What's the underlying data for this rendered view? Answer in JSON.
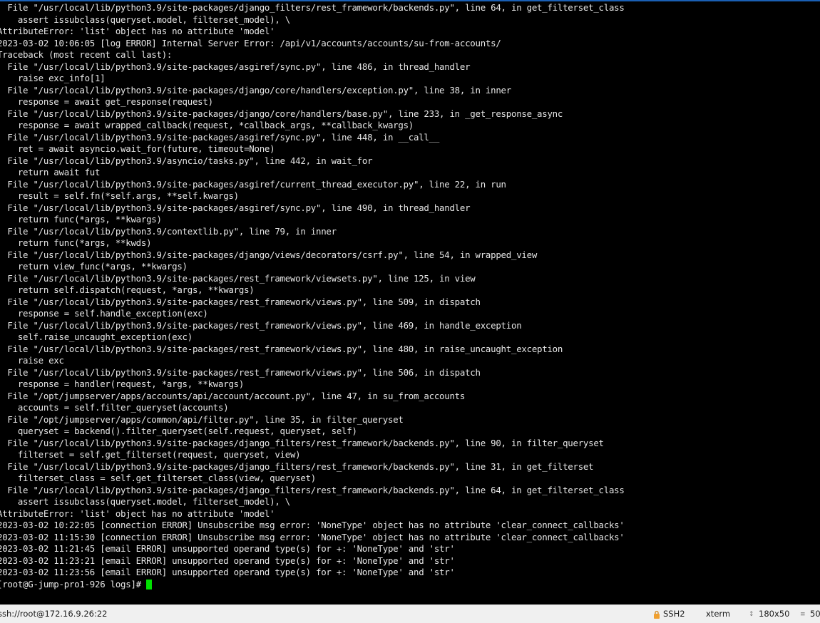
{
  "terminal": {
    "lines": [
      "  File \"/usr/local/lib/python3.9/site-packages/django_filters/rest_framework/backends.py\", line 64, in get_filterset_class",
      "    assert issubclass(queryset.model, filterset_model), \\",
      "AttributeError: 'list' object has no attribute 'model'",
      "2023-03-02 10:06:05 [log ERROR] Internal Server Error: /api/v1/accounts/accounts/su-from-accounts/",
      "Traceback (most recent call last):",
      "  File \"/usr/local/lib/python3.9/site-packages/asgiref/sync.py\", line 486, in thread_handler",
      "    raise exc_info[1]",
      "  File \"/usr/local/lib/python3.9/site-packages/django/core/handlers/exception.py\", line 38, in inner",
      "    response = await get_response(request)",
      "  File \"/usr/local/lib/python3.9/site-packages/django/core/handlers/base.py\", line 233, in _get_response_async",
      "    response = await wrapped_callback(request, *callback_args, **callback_kwargs)",
      "  File \"/usr/local/lib/python3.9/site-packages/asgiref/sync.py\", line 448, in __call__",
      "    ret = await asyncio.wait_for(future, timeout=None)",
      "  File \"/usr/local/lib/python3.9/asyncio/tasks.py\", line 442, in wait_for",
      "    return await fut",
      "  File \"/usr/local/lib/python3.9/site-packages/asgiref/current_thread_executor.py\", line 22, in run",
      "    result = self.fn(*self.args, **self.kwargs)",
      "  File \"/usr/local/lib/python3.9/site-packages/asgiref/sync.py\", line 490, in thread_handler",
      "    return func(*args, **kwargs)",
      "  File \"/usr/local/lib/python3.9/contextlib.py\", line 79, in inner",
      "    return func(*args, **kwds)",
      "  File \"/usr/local/lib/python3.9/site-packages/django/views/decorators/csrf.py\", line 54, in wrapped_view",
      "    return view_func(*args, **kwargs)",
      "  File \"/usr/local/lib/python3.9/site-packages/rest_framework/viewsets.py\", line 125, in view",
      "    return self.dispatch(request, *args, **kwargs)",
      "  File \"/usr/local/lib/python3.9/site-packages/rest_framework/views.py\", line 509, in dispatch",
      "    response = self.handle_exception(exc)",
      "  File \"/usr/local/lib/python3.9/site-packages/rest_framework/views.py\", line 469, in handle_exception",
      "    self.raise_uncaught_exception(exc)",
      "  File \"/usr/local/lib/python3.9/site-packages/rest_framework/views.py\", line 480, in raise_uncaught_exception",
      "    raise exc",
      "  File \"/usr/local/lib/python3.9/site-packages/rest_framework/views.py\", line 506, in dispatch",
      "    response = handler(request, *args, **kwargs)",
      "  File \"/opt/jumpserver/apps/accounts/api/account/account.py\", line 47, in su_from_accounts",
      "    accounts = self.filter_queryset(accounts)",
      "  File \"/opt/jumpserver/apps/common/api/filter.py\", line 35, in filter_queryset",
      "    queryset = backend().filter_queryset(self.request, queryset, self)",
      "  File \"/usr/local/lib/python3.9/site-packages/django_filters/rest_framework/backends.py\", line 90, in filter_queryset",
      "    filterset = self.get_filterset(request, queryset, view)",
      "  File \"/usr/local/lib/python3.9/site-packages/django_filters/rest_framework/backends.py\", line 31, in get_filterset",
      "    filterset_class = self.get_filterset_class(view, queryset)",
      "  File \"/usr/local/lib/python3.9/site-packages/django_filters/rest_framework/backends.py\", line 64, in get_filterset_class",
      "    assert issubclass(queryset.model, filterset_model), \\",
      "AttributeError: 'list' object has no attribute 'model'",
      "2023-03-02 10:22:05 [connection ERROR] Unsubscribe msg error: 'NoneType' object has no attribute 'clear_connect_callbacks'",
      "2023-03-02 11:15:30 [connection ERROR] Unsubscribe msg error: 'NoneType' object has no attribute 'clear_connect_callbacks'",
      "2023-03-02 11:21:45 [email ERROR] unsupported operand type(s) for +: 'NoneType' and 'str'",
      "2023-03-02 11:23:21 [email ERROR] unsupported operand type(s) for +: 'NoneType' and 'str'",
      "2023-03-02 11:23:56 [email ERROR] unsupported operand type(s) for +: 'NoneType' and 'str'"
    ],
    "prompt": "[root@G-jump-pro1-926 logs]# ",
    "cursor_color": "#00e000",
    "text_color": "#e6e6e6",
    "background_color": "#000000"
  },
  "statusbar": {
    "connection": "ssh://root@172.16.9.26:22",
    "protocol": "SSH2",
    "terminal_type": "xterm",
    "size": "180x50",
    "lines_label": "50",
    "lock_icon": "lock-icon",
    "resize_icon": "resize-icon",
    "rows_icon": "rows-icon"
  }
}
